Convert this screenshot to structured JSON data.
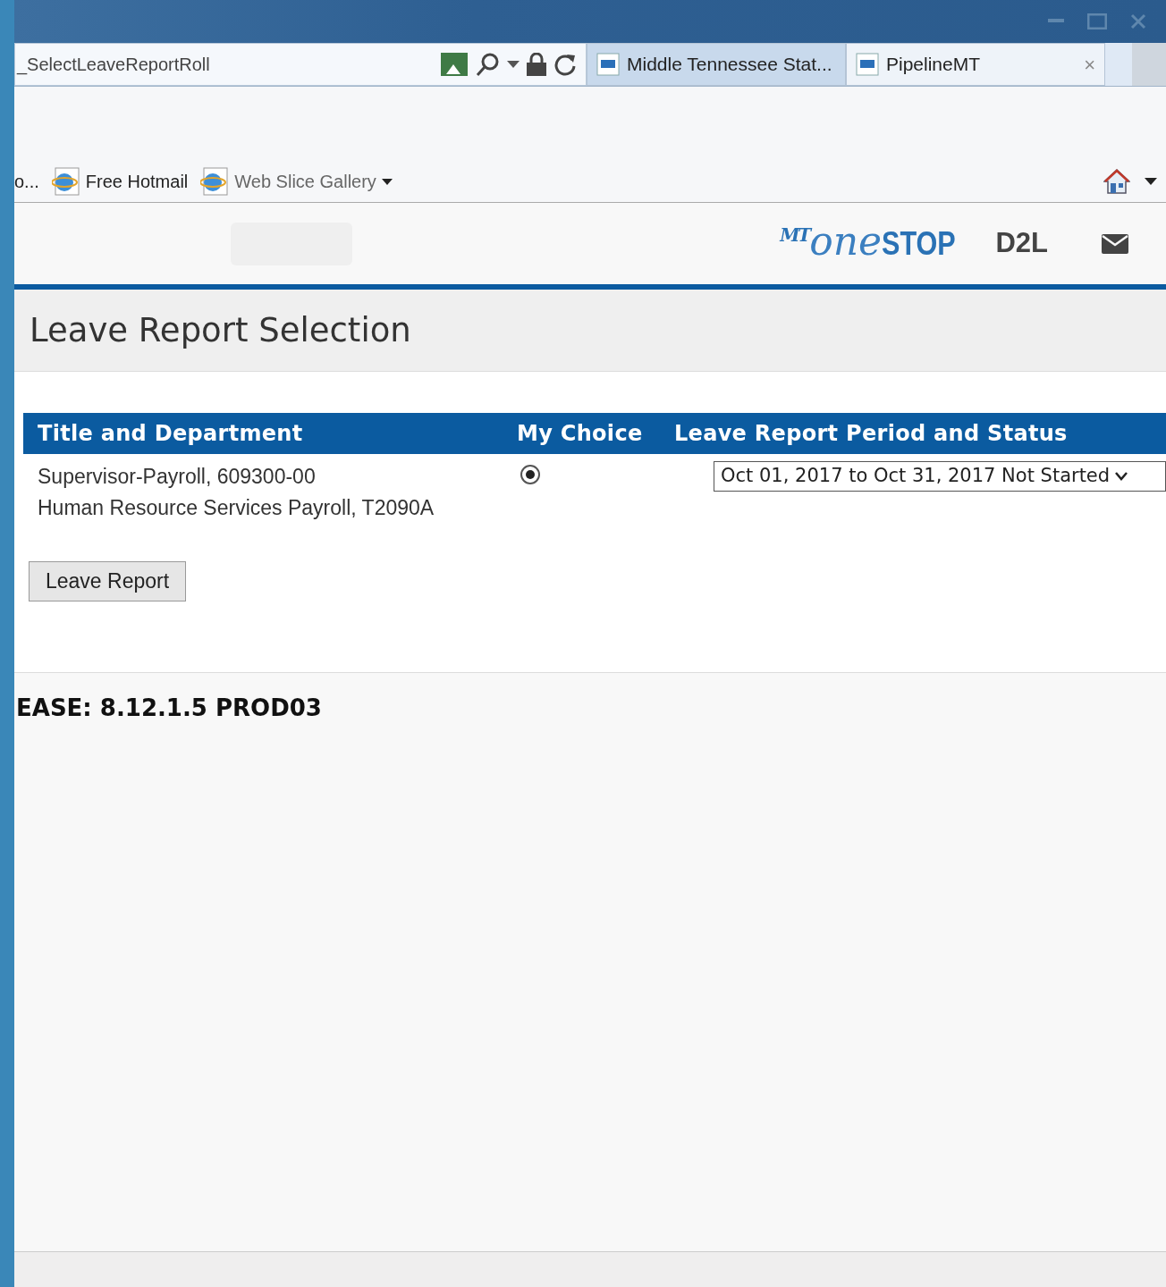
{
  "browser": {
    "address": "_SelectLeaveReportRoll",
    "tabs": [
      {
        "label": "Middle Tennessee Stat...",
        "selected": true
      },
      {
        "label": "PipelineMT",
        "selected": false,
        "close": "×"
      }
    ],
    "favorites": [
      {
        "label": "o...",
        "kind": "plain"
      },
      {
        "label": "Free Hotmail",
        "kind": "link"
      },
      {
        "label": "Web Slice Gallery",
        "kind": "menu"
      }
    ]
  },
  "header": {
    "logo": {
      "mark": "MT",
      "word": "one",
      "accent": "STOP"
    },
    "links": [
      "D2L"
    ]
  },
  "page_title": "Leave Report Selection",
  "table": {
    "columns": [
      "Title and Department",
      "My Choice",
      "Leave Report Period and Status"
    ],
    "rows": [
      {
        "title": "Supervisor-Payroll, 609300-00",
        "department": "Human Resource Services Payroll, T2090A",
        "selected": true,
        "period": "Oct 01, 2017 to Oct 31, 2017 Not Started"
      }
    ]
  },
  "button": "Leave Report",
  "release": "EASE: 8.12.1.5 PROD03"
}
